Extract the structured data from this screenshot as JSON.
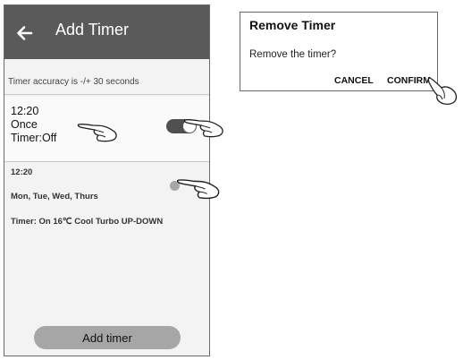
{
  "header": {
    "back_icon": "arrow-left-icon",
    "title": "Add Timer"
  },
  "accuracy_note": "Timer accuracy is -/+ 30 seconds",
  "timer_1": {
    "time": "12:20",
    "repeat": "Once",
    "action": "Timer:Off",
    "toggle_on": true
  },
  "timer_2": {
    "time": "12:20",
    "days": "Mon, Tue, Wed, Thurs",
    "settings": "Timer: On 16℃  Cool  Turbo  UP-DOWN"
  },
  "add_button_label": "Add timer",
  "dialog": {
    "title": "Remove Timer",
    "message": "Remove the timer?",
    "cancel_label": "CANCEL",
    "confirm_label": "CONFIRM"
  },
  "colors": {
    "header_bg": "#5a5a5a",
    "screen_bg": "#f3f3f3",
    "toggle_on": "#505050",
    "button_bg": "#a6a6a6"
  }
}
